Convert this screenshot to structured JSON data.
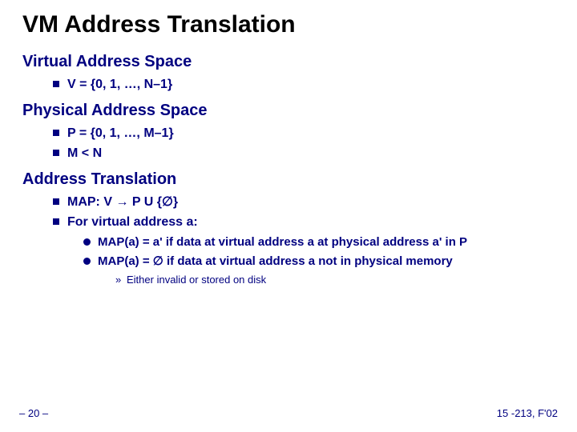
{
  "title": "VM Address Translation",
  "sections": {
    "virtual": {
      "header": "Virtual Address Space",
      "item0": "V = {0, 1, …, N–1}"
    },
    "physical": {
      "header": "Physical Address Space",
      "item0": "P = {0, 1, …, M–1}",
      "item1": "M < N"
    },
    "translation": {
      "header": "Address Translation",
      "item0": "MAP:  V → P  U  {∅}",
      "item1": "For virtual address a:",
      "sub0": "MAP(a)  =  a'  if data at virtual address a at physical address a' in P",
      "sub1": "MAP(a)  = ∅ if data at virtual address a not in physical memory",
      "sub1a": "Either invalid or stored on disk"
    }
  },
  "footer": {
    "left": "– 20 –",
    "right": "15 -213, F'02"
  }
}
